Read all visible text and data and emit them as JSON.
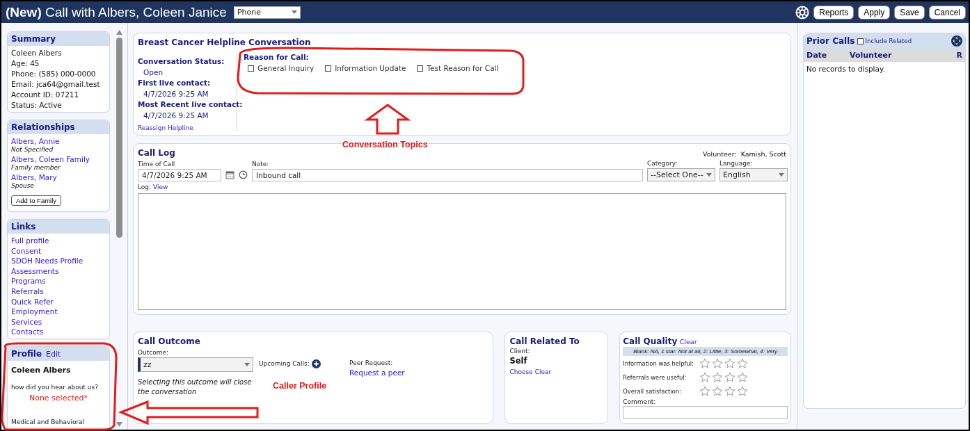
{
  "header": {
    "title_prefix": "(New)",
    "title": "Call with Albers, Coleen Janice",
    "channel": "Phone",
    "buttons": [
      "Reports",
      "Apply",
      "Save",
      "Cancel"
    ]
  },
  "summary": {
    "title": "Summary",
    "lines": [
      "Coleen Albers",
      "Age: 45",
      "Phone: (585) 000-0000",
      "Email: jca64@gmail.test",
      "Account ID: 07211",
      "Status: Active"
    ]
  },
  "relationships": {
    "title": "Relationships",
    "items": [
      {
        "name": "Albers, Annie",
        "relation": "Not Specified"
      },
      {
        "name": "Albers, Coleen Family",
        "relation": "Family member"
      },
      {
        "name": "Albers, Mary",
        "relation": "Spouse"
      }
    ],
    "button": "Add to Family"
  },
  "links": {
    "title": "Links",
    "items": [
      "Full profile",
      "Consent",
      "SDOH Needs Profile",
      "Assessments",
      "Programs",
      "Referrals",
      "Quick Refer",
      "Employment",
      "Services",
      "Contacts"
    ]
  },
  "profile": {
    "title": "Profile",
    "edit": "Edit",
    "name": "Coleen Albers",
    "question": "how did you hear about us?",
    "answer": "None selected*",
    "section": "Medical and Behavioral"
  },
  "conversation": {
    "title": "Breast Cancer Helpline Conversation",
    "fields": [
      {
        "label": "Conversation Status:",
        "value": "Open"
      },
      {
        "label": "First live contact:",
        "value": "4/7/2026 9:25 AM"
      },
      {
        "label": "Most Recent live contact:",
        "value": "4/7/2026 9:25 AM"
      }
    ],
    "reassign": "Reassign Helpline",
    "reason_label": "Reason for Call:",
    "reasons": [
      {
        "label": "General Inquiry",
        "checked": false
      },
      {
        "label": "Information Update",
        "checked": false
      },
      {
        "label": "Test Reason for Call",
        "checked": false
      }
    ]
  },
  "call_log": {
    "title": "Call Log",
    "volunteer_label": "Volunteer:",
    "volunteer": "Kamish, Scott",
    "time_label": "Time of Call",
    "time": "4/7/2026 9:25 AM",
    "note_label": "Note:",
    "note": "Inbound call",
    "category_label": "Category:",
    "category": "--Select One--",
    "language_label": "Language:",
    "language": "English",
    "log_label": "Log:",
    "log_link": "View"
  },
  "outcome": {
    "title": "Call Outcome",
    "outcome_label": "Outcome:",
    "outcome": "zz",
    "warning": "Selecting this outcome will close the conversation",
    "upcoming_label": "Upcoming Calls:",
    "peer_label": "Peer Request:",
    "peer_link": "Request a peer"
  },
  "related": {
    "title": "Call Related To",
    "client_label": "Client:",
    "client": "Self",
    "links": [
      "Choose",
      "Clear"
    ]
  },
  "quality": {
    "title": "Call Quality",
    "clear": "Clear",
    "legend": "Blank: NA, 1 star: Not at all, 2: Little, 3: Somewhat, 4: Very",
    "ratings": [
      {
        "label": "Information was helpful:",
        "stars": 0
      },
      {
        "label": "Referrals were useful:",
        "stars": 0
      },
      {
        "label": "Overall satisfaction:",
        "stars": 0
      }
    ],
    "comment_label": "Comment:"
  },
  "prior_calls": {
    "title": "Prior Calls",
    "include_related": {
      "label": "Include Related",
      "checked": false
    },
    "columns": [
      "Date",
      "Volunteer",
      "R"
    ],
    "empty": "No records to display."
  },
  "annotations": [
    {
      "text": "Conversation Topics"
    },
    {
      "text": "Caller Profile"
    }
  ]
}
